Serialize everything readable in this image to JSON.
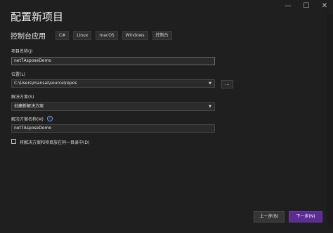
{
  "window": {
    "title": "配置新项目",
    "controls": {
      "minimize": "—",
      "maximize": "☐",
      "close": "✕"
    }
  },
  "template": {
    "name": "控制台应用",
    "tags": [
      "C#",
      "Linux",
      "macOS",
      "Windows",
      "控制台"
    ]
  },
  "form": {
    "project_name": {
      "label": "项目名称(J)",
      "value": "net7AsposeDemo"
    },
    "location": {
      "label": "位置(L)",
      "value": "C:\\Users\\mansai\\source\\repos",
      "browse_label": "..."
    },
    "solution": {
      "label": "解决方案(S)",
      "value": "创建新解决方案"
    },
    "solution_name": {
      "label": "解决方案名称(M)",
      "value": "net7AsposeDemo",
      "info_icon": "i"
    },
    "same_dir": {
      "label": "将解决方案和项目放在同一目录中(D)",
      "checked": false
    }
  },
  "footer": {
    "back_label": "上一步(B)",
    "next_label": "下一步(N)"
  },
  "colors": {
    "background": "#1f1f1f",
    "accent": "#5c2d91",
    "info": "#59a8ff"
  }
}
